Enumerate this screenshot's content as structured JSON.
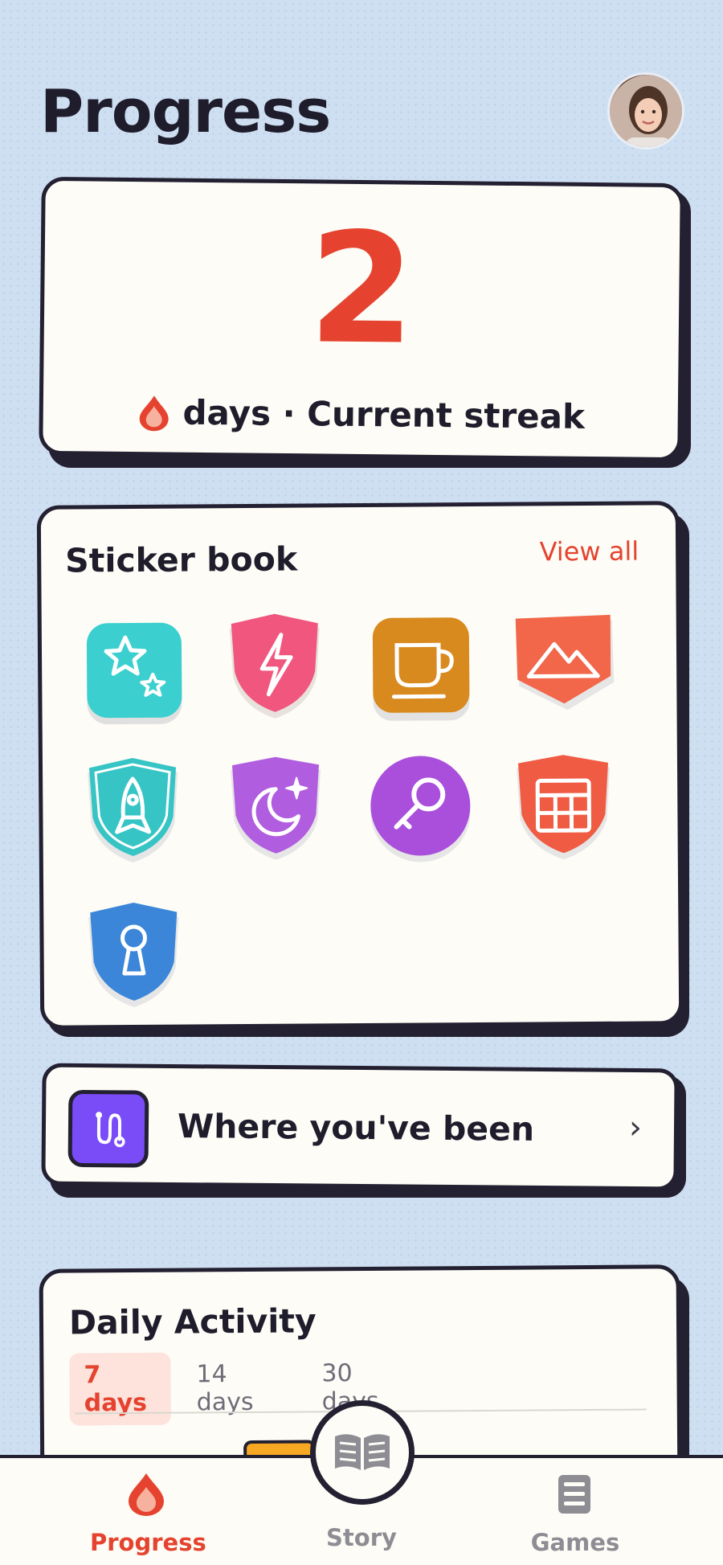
{
  "header": {
    "title": "Progress"
  },
  "streak": {
    "value": "2",
    "label": "days · Current streak"
  },
  "sticker_book": {
    "title": "Sticker book",
    "view_all": "View all",
    "stickers": [
      {
        "icon": "stars-icon",
        "color": "#3ccfcf"
      },
      {
        "icon": "lightning-icon",
        "color": "#f0567e"
      },
      {
        "icon": "coffee-cup-icon",
        "color": "#d98a1f"
      },
      {
        "icon": "mountain-icon",
        "color": "#f2664a"
      },
      {
        "icon": "rocket-icon",
        "color": "#36c4c4"
      },
      {
        "icon": "moon-star-icon",
        "color": "#b15de0"
      },
      {
        "icon": "magnifier-icon",
        "color": "#a94fdc"
      },
      {
        "icon": "calendar-grid-icon",
        "color": "#ef5b43"
      },
      {
        "icon": "keyhole-icon",
        "color": "#3b86d9"
      }
    ]
  },
  "where_been": {
    "label": "Where you've been",
    "chevron": "›"
  },
  "daily_activity": {
    "title": "Daily Activity",
    "tabs": [
      "7 days",
      "14 days",
      "30 days"
    ],
    "active_tab": "7 days"
  },
  "nav": {
    "progress": "Progress",
    "story": "Story",
    "games": "Games",
    "active": "Progress"
  },
  "colors": {
    "accent": "#e5432f",
    "outline": "#232031",
    "card": "#fdfcf6",
    "background": "#cfdff2",
    "route_icon_bg": "#7a4cf7"
  }
}
